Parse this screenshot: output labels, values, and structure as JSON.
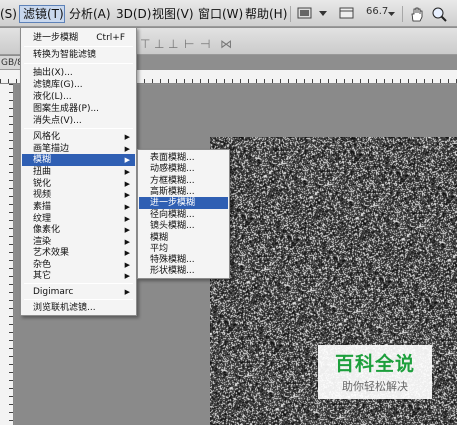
{
  "menubar": {
    "items": [
      {
        "id": "s",
        "label": "(S)"
      },
      {
        "id": "filter",
        "label": "滤镜(T)"
      },
      {
        "id": "analysis",
        "label": "分析(A)"
      },
      {
        "id": "3d",
        "label": "3D(D)"
      },
      {
        "id": "view",
        "label": "视图(V)"
      },
      {
        "id": "window",
        "label": "窗口(W)"
      },
      {
        "id": "help",
        "label": "帮助(H)"
      }
    ],
    "zoom_level": "66.7"
  },
  "doc_tab": "GB/8",
  "filter_menu": {
    "items": [
      {
        "label": "进一步模糊",
        "shortcut": "Ctrl+F"
      },
      {
        "label": "转换为智能滤镜"
      },
      {
        "label": "抽出(X)..."
      },
      {
        "label": "滤镜库(G)..."
      },
      {
        "label": "液化(L)..."
      },
      {
        "label": "图案生成器(P)..."
      },
      {
        "label": "消失点(V)..."
      },
      {
        "label": "风格化",
        "submenu": true
      },
      {
        "label": "画笔描边",
        "submenu": true
      },
      {
        "label": "模糊",
        "submenu": true,
        "highlighted": true
      },
      {
        "label": "扭曲",
        "submenu": true
      },
      {
        "label": "锐化",
        "submenu": true
      },
      {
        "label": "视频",
        "submenu": true
      },
      {
        "label": "素描",
        "submenu": true
      },
      {
        "label": "纹理",
        "submenu": true
      },
      {
        "label": "像素化",
        "submenu": true
      },
      {
        "label": "渲染",
        "submenu": true
      },
      {
        "label": "艺术效果",
        "submenu": true
      },
      {
        "label": "杂色",
        "submenu": true
      },
      {
        "label": "其它",
        "submenu": true
      },
      {
        "label": "Digimarc",
        "submenu": true
      },
      {
        "label": "浏览联机滤镜..."
      }
    ]
  },
  "blur_menu": {
    "items": [
      {
        "label": "表面模糊..."
      },
      {
        "label": "动感模糊..."
      },
      {
        "label": "方框模糊..."
      },
      {
        "label": "高斯模糊..."
      },
      {
        "label": "进一步模糊",
        "highlighted": true
      },
      {
        "label": "径向模糊..."
      },
      {
        "label": "镜头模糊..."
      },
      {
        "label": "模糊"
      },
      {
        "label": "平均"
      },
      {
        "label": "特殊模糊..."
      },
      {
        "label": "形状模糊..."
      }
    ]
  },
  "watermark": {
    "title": "百科全说",
    "subtitle": "助你轻松解决"
  },
  "colors": {
    "menu_highlight": "#2f5fb3",
    "watermark_green": "#1d9f3c"
  }
}
